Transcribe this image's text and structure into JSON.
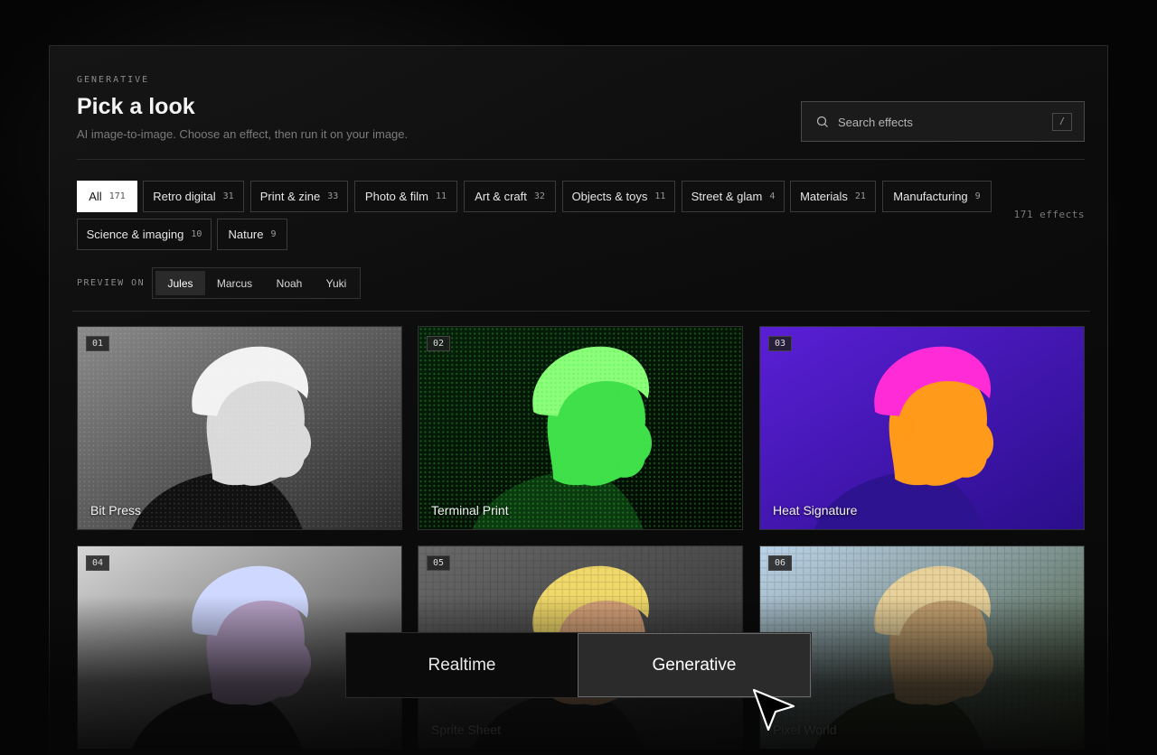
{
  "header": {
    "eyebrow": "GENERATIVE",
    "title": "Pick a look",
    "subtitle": "AI image-to-image. Choose an effect, then run it on your image."
  },
  "search": {
    "placeholder": "Search effects",
    "shortcut": "/",
    "icon": "search-icon"
  },
  "categories": [
    {
      "label": "All",
      "count": "171",
      "active": true
    },
    {
      "label": "Retro digital",
      "count": "31"
    },
    {
      "label": "Print & zine",
      "count": "33"
    },
    {
      "label": "Photo & film",
      "count": "11"
    },
    {
      "label": "Art & craft",
      "count": "32"
    },
    {
      "label": "Objects & toys",
      "count": "11"
    },
    {
      "label": "Street & glam",
      "count": "4"
    },
    {
      "label": "Materials",
      "count": "21"
    },
    {
      "label": "Manufacturing",
      "count": "9"
    },
    {
      "label": "Science & imaging",
      "count": "10"
    },
    {
      "label": "Nature",
      "count": "9"
    }
  ],
  "effects_count": "171 effects",
  "preview": {
    "label": "PREVIEW ON",
    "options": [
      "Jules",
      "Marcus",
      "Noah",
      "Yuki"
    ],
    "selected": "Jules"
  },
  "effects": [
    {
      "num": "01",
      "name": "Bit Press"
    },
    {
      "num": "02",
      "name": "Terminal Print"
    },
    {
      "num": "03",
      "name": "Heat Signature"
    },
    {
      "num": "04",
      "name": ""
    },
    {
      "num": "05",
      "name": "Sprite Sheet"
    },
    {
      "num": "06",
      "name": "Pixel World"
    }
  ],
  "mode_switch": {
    "options": [
      "Realtime",
      "Generative"
    ],
    "selected": "Generative"
  },
  "colors": {
    "background": "#050505",
    "accent_active_chip": "#ffffff",
    "terminal_green": "#39d43a",
    "heat_magenta": "#ff2bd6",
    "heat_orange": "#ffa21a",
    "heat_violet": "#5a1fd6"
  }
}
